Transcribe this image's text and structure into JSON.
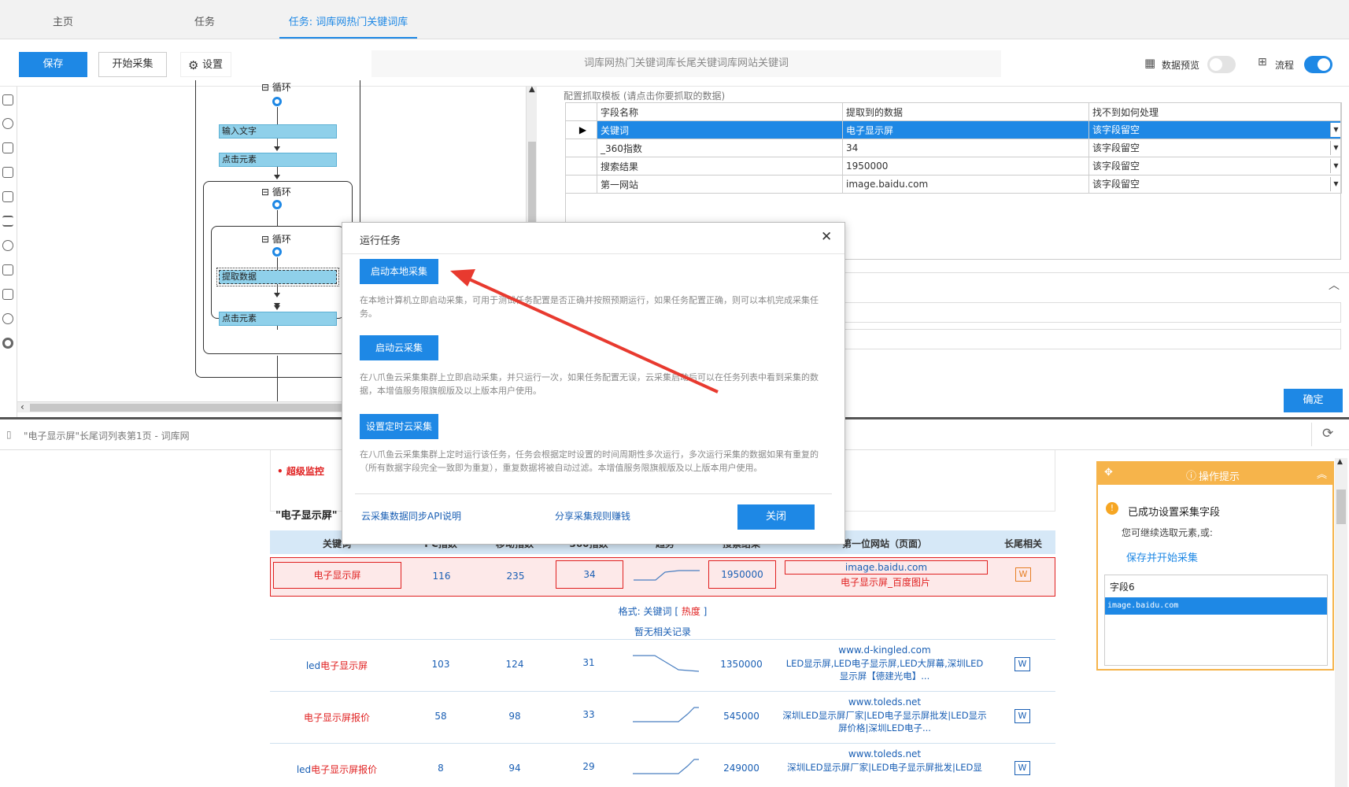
{
  "tabs": [
    {
      "label": "主页"
    },
    {
      "label": "任务"
    },
    {
      "label": "任务: 词库网热门关键词库长..."
    }
  ],
  "toolbar": {
    "save": "保存",
    "start": "开始采集",
    "settings": "设置",
    "task_title": "词库网热门关键词库长尾关键词库网站关键词",
    "data_preview": "数据预览",
    "flow": "流程"
  },
  "flow": {
    "loop1": "循环",
    "input_text": "输入文字",
    "click1": "点击元素",
    "loop2": "循环",
    "loop3": "循环",
    "extract": "提取数据",
    "click2": "点击元素"
  },
  "fields": {
    "title": "配置抓取模板 (请点击你要抓取的数据)",
    "headers": [
      "字段名称",
      "提取到的数据",
      "找不到如何处理"
    ],
    "rows": [
      {
        "name": "关键词",
        "value": "电子显示屏",
        "handle": "该字段留空"
      },
      {
        "name": "_360指数",
        "value": "34",
        "handle": "该字段留空"
      },
      {
        "name": "搜索结果",
        "value": "1950000",
        "handle": "该字段留空"
      },
      {
        "name": "第一网站",
        "value": "image.baidu.com",
        "handle": "该字段留空"
      }
    ],
    "confirm": "确定"
  },
  "browser": {
    "url": "\"电子显示屏\"长尾词列表第1页 - 词库网"
  },
  "web": {
    "super_monitor": "• 超级监控",
    "section_title": "\"电子显示屏\"",
    "headers": [
      "关键词",
      "PC指数",
      "移动指数",
      "360指数",
      "趋势",
      "搜索结果",
      "第一位网站（页面）",
      "长尾相关"
    ],
    "main_row": {
      "kw": "电子显示屏",
      "pc": "116",
      "mobile": "235",
      "i360": "34",
      "results": "1950000",
      "site": "image.baidu.com",
      "site_title": "电子显示屏_百度图片"
    },
    "format_prefix": "格式: ",
    "format_kw": "关键词",
    "format_open": " [ ",
    "format_hot": "热度",
    "format_close": " ]",
    "no_record": "暂无相关记录",
    "rows": [
      {
        "kw_a": "led",
        "kw_b": "电子显示屏",
        "pc": "103",
        "mobile": "124",
        "i360": "31",
        "results": "1350000",
        "site": "www.d-kingled.com",
        "desc": "LED显示屏,LED电子显示屏,LED大屏幕,深圳LED显示屏【德建光电】..."
      },
      {
        "kw_a": "",
        "kw_b": "电子显示屏报价",
        "pc": "58",
        "mobile": "98",
        "i360": "33",
        "results": "545000",
        "site": "www.toleds.net",
        "desc": "深圳LED显示屏厂家|LED电子显示屏批发|LED显示屏价格|深圳LED电子..."
      },
      {
        "kw_a": "led",
        "kw_b": "电子显示屏报价",
        "pc": "8",
        "mobile": "94",
        "i360": "29",
        "results": "249000",
        "site": "www.toleds.net",
        "desc": "深圳LED显示屏厂家|LED电子显示屏批发|LED显"
      }
    ]
  },
  "tip": {
    "title": "操作提示",
    "success": "已成功设置采集字段",
    "hint": "您可继续选取元素,或:",
    "link": "保存并开始采集",
    "field": "字段6",
    "value": "image.baidu.com"
  },
  "dialog": {
    "title": "运行任务",
    "local_btn": "启动本地采集",
    "local_desc": "在本地计算机立即启动采集，可用于测试任务配置是否正确并按照预期运行，如果任务配置正确，则可以本机完成采集任务。",
    "cloud_btn": "启动云采集",
    "cloud_desc": "在八爪鱼云采集集群上立即启动采集，并只运行一次，如果任务配置无误，云采集启动后可以在任务列表中看到采集的数据，本增值服务限旗舰版及以上版本用户使用。",
    "schedule_btn": "设置定时云采集",
    "schedule_desc": "在八爪鱼云采集集群上定时运行该任务，任务会根据定时设置的时间周期性多次运行，多次运行采集的数据如果有重复的（所有数据字段完全一致即为重复），重复数据将被自动过滤。本增值服务限旗舰版及以上版本用户使用。",
    "api_link": "云采集数据同步API说明",
    "share_link": "分享采集规则赚钱",
    "close_btn": "关闭"
  },
  "colors": {
    "accent": "#1e88e5",
    "highlight": "#e02020",
    "tip_border": "#f6b44b"
  }
}
